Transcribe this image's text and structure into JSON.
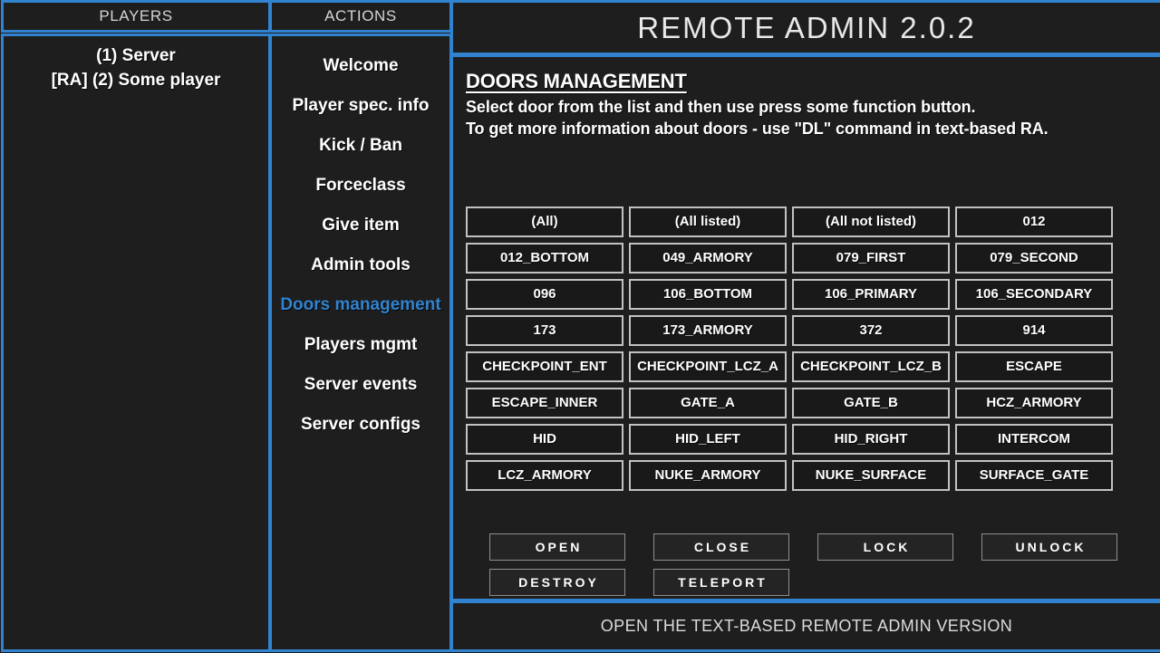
{
  "window": {
    "accent_color": "#3183d0",
    "panel_bg": "#1e1e1e",
    "app_background": "#1b1b1b"
  },
  "players_panel": {
    "header": "PLAYERS",
    "items": [
      "(1) Server",
      "[RA] (2) Some player"
    ]
  },
  "actions_panel": {
    "header": "ACTIONS",
    "active_index": 6,
    "items": [
      {
        "label": "Welcome"
      },
      {
        "label": "Player spec. info"
      },
      {
        "label": "Kick / Ban"
      },
      {
        "label": "Forceclass"
      },
      {
        "label": "Give item"
      },
      {
        "label": "Admin tools"
      },
      {
        "label": "Doors management"
      },
      {
        "label": "Players mgmt"
      },
      {
        "label": "Server events"
      },
      {
        "label": "Server configs"
      }
    ]
  },
  "main": {
    "title": "REMOTE ADMIN 2.0.2",
    "section_title": "DOORS MANAGEMENT",
    "description_line_1": "Select door from the list and then use press some function button.",
    "description_line_2": "To get more information about doors - use \"DL\" command in text-based RA.",
    "doors": [
      "(All)",
      "(All listed)",
      "(All not listed)",
      "012",
      "012_BOTTOM",
      "049_ARMORY",
      "079_FIRST",
      "079_SECOND",
      "096",
      "106_BOTTOM",
      "106_PRIMARY",
      "106_SECONDARY",
      "173",
      "173_ARMORY",
      "372",
      "914",
      "CHECKPOINT_ENT",
      "CHECKPOINT_LCZ_A",
      "CHECKPOINT_LCZ_B",
      "ESCAPE",
      "ESCAPE_INNER",
      "GATE_A",
      "GATE_B",
      "HCZ_ARMORY",
      "HID",
      "HID_LEFT",
      "HID_RIGHT",
      "INTERCOM",
      "LCZ_ARMORY",
      "NUKE_ARMORY",
      "NUKE_SURFACE",
      "SURFACE_GATE"
    ],
    "functions": [
      "OPEN",
      "CLOSE",
      "LOCK",
      "UNLOCK",
      "DESTROY",
      "TELEPORT"
    ]
  },
  "bottom_bar": {
    "label": "OPEN THE TEXT-BASED REMOTE ADMIN VERSION"
  }
}
